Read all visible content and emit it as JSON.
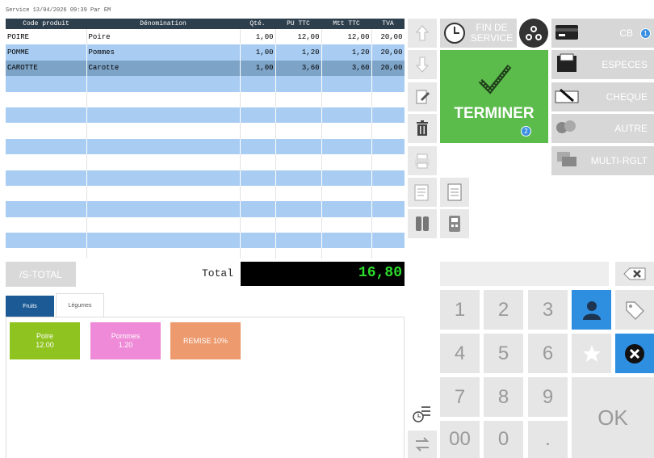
{
  "header": {
    "service": "Service 13/04/2026 09:39  Par EM"
  },
  "table": {
    "columns": [
      "Code produit",
      "Dénomination",
      "Qté.",
      "PU TTC",
      "Mtt TTC",
      "TVA"
    ],
    "rows": [
      {
        "code": "POIRE",
        "name": "Poire",
        "qty": "1,00",
        "pu": "12,00",
        "mtt": "12,00",
        "tva": "20,00"
      },
      {
        "code": "POMME",
        "name": "Pommes",
        "qty": "1,00",
        "pu": "1,20",
        "mtt": "1,20",
        "tva": "20,00"
      },
      {
        "code": "CAROTTE",
        "name": "Carotte",
        "qty": "1,00",
        "pu": "3,60",
        "mtt": "3,60",
        "tva": "20,00"
      }
    ]
  },
  "totals": {
    "subtotal_label": "/S-TOTAL",
    "total_label": "Total",
    "total_value": "16,80"
  },
  "tabs": [
    "Fruits",
    "Légumes"
  ],
  "products": [
    {
      "line1": "Poire",
      "line2": "12.00",
      "color": "#8fc31f"
    },
    {
      "line1": "Pommes",
      "line2": "1.20",
      "color": "#ee8ad7"
    },
    {
      "line1": "REMISE 10%",
      "line2": "",
      "color": "#ec9a6e"
    }
  ],
  "actions": {
    "fin_service": "FIN DE SERVICE",
    "terminer": "TERMINER",
    "terminer_badge": "2"
  },
  "payments": [
    {
      "label": "CB",
      "badge": "1",
      "icon": "credit-card-icon"
    },
    {
      "label": "ESPECES",
      "icon": "cash-icon"
    },
    {
      "label": "CHEQUE",
      "icon": "cheque-icon"
    },
    {
      "label": "AUTRE",
      "icon": "other-payment-icon"
    },
    {
      "label": "MULTI-RGLT",
      "icon": "multi-payment-icon"
    }
  ],
  "keypad": {
    "keys": [
      "1",
      "2",
      "3",
      "4",
      "5",
      "6",
      "7",
      "8",
      "9",
      "00",
      "0",
      "."
    ],
    "ok": "OK"
  },
  "colors": {
    "accent_green": "#5bbb4b",
    "header_dark": "#2d3e4c",
    "row_blue": "#a9cdf2",
    "row_selected": "#7da3c7",
    "tab_blue": "#1c5a96",
    "key_blue": "#2e8ee0"
  }
}
